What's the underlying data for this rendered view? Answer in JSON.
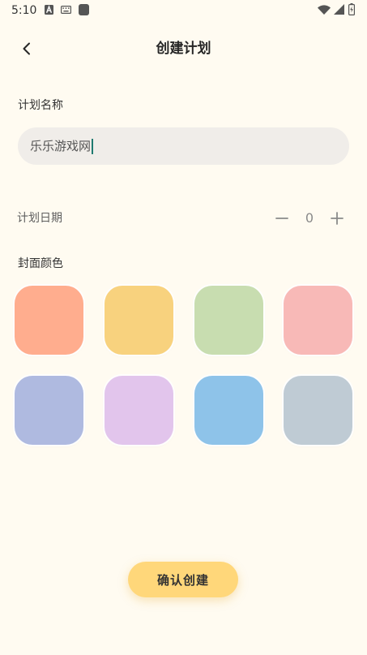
{
  "status_bar": {
    "time": "5:10",
    "left_icons": [
      "a-notification-icon",
      "keyboard-icon",
      "app-square-icon"
    ],
    "right_icons": [
      "wifi-icon",
      "signal-icon",
      "battery-charging-icon"
    ]
  },
  "header": {
    "back_icon": "chevron-left-icon",
    "title": "创建计划"
  },
  "plan_name": {
    "label": "计划名称",
    "value": "乐乐游戏网"
  },
  "plan_date": {
    "label": "计划日期",
    "value": "0",
    "decrement_icon": "minus-icon",
    "increment_icon": "plus-icon"
  },
  "cover_color": {
    "label": "封面颜色",
    "colors": [
      "#FFAD8E",
      "#F8D27E",
      "#C8DDB0",
      "#F8B9B7",
      "#AFBAE0",
      "#E2C5EC",
      "#8EC3E9",
      "#BFCBD4"
    ]
  },
  "confirm_button": {
    "label": "确认创建"
  },
  "theme": {
    "background": "#FFFBF1",
    "input_background": "#F0EDE9",
    "accent": "#1F7A70",
    "button_background": "#FFD77A"
  }
}
